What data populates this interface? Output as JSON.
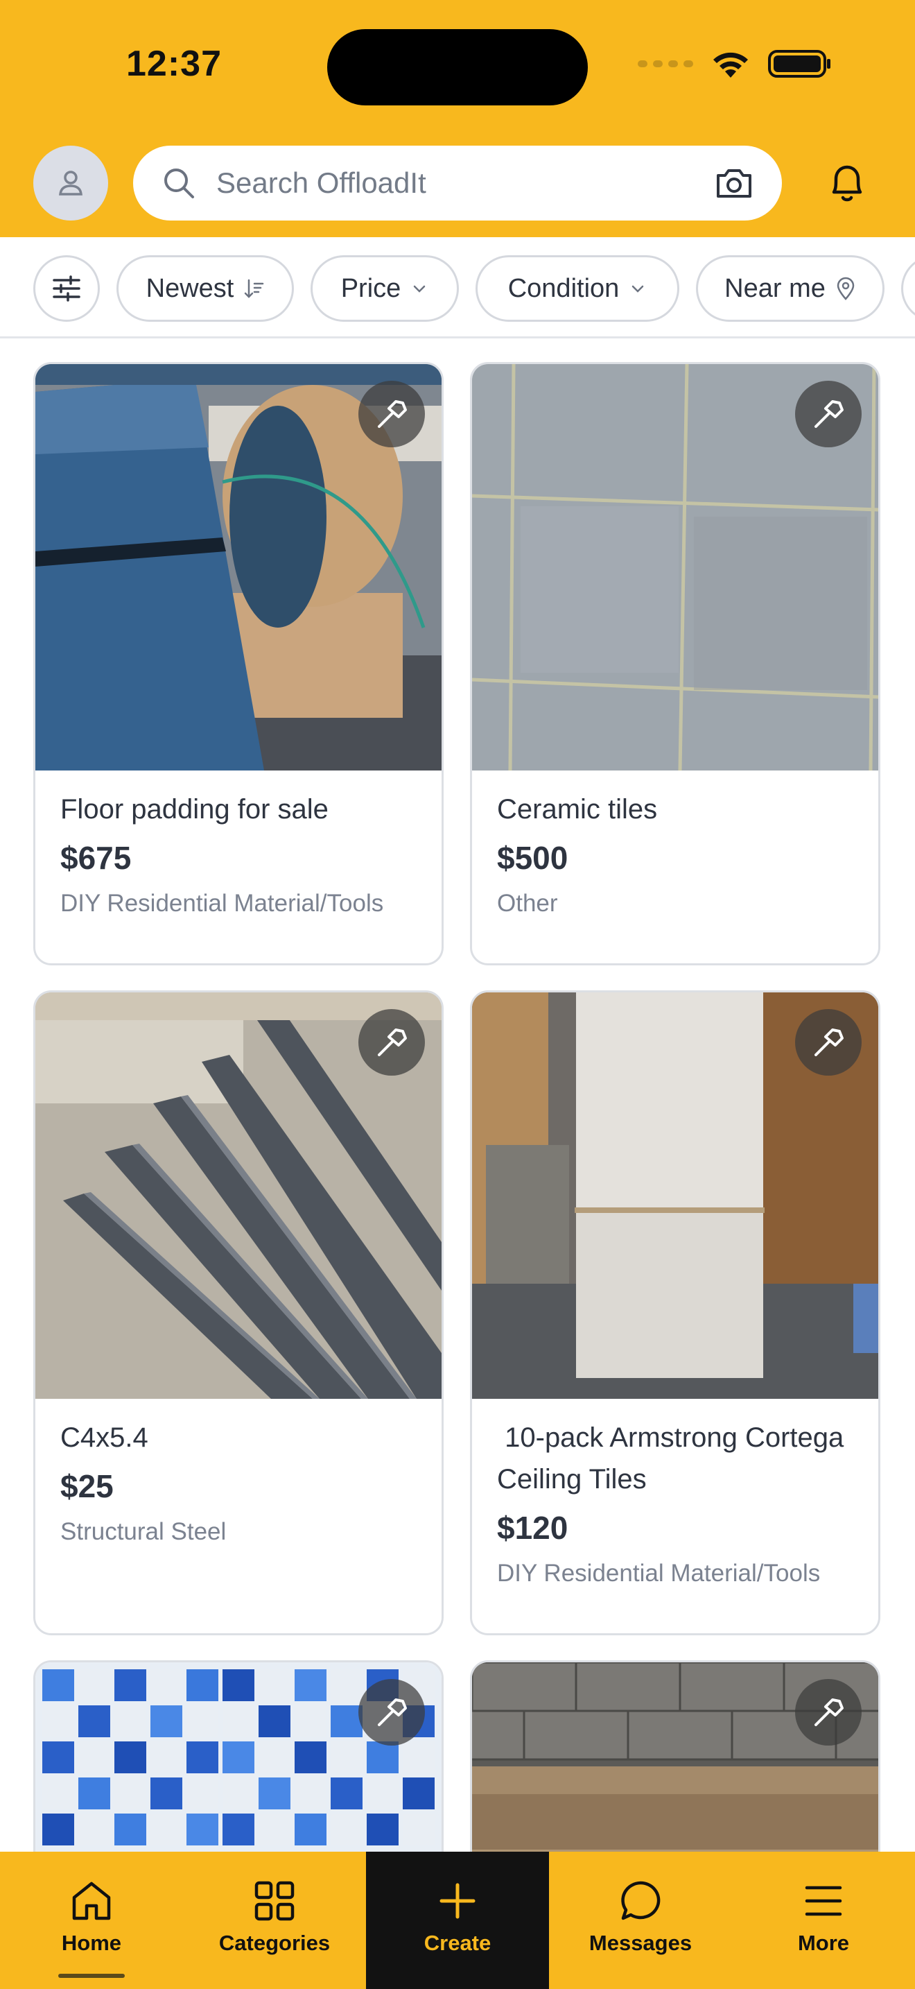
{
  "status_bar": {
    "time": "12:37"
  },
  "header": {
    "search_placeholder": "Search OffloadIt"
  },
  "filters": [
    {
      "label": "Newest"
    },
    {
      "label": "Price"
    },
    {
      "label": "Condition"
    },
    {
      "label": "Near me"
    }
  ],
  "listings": [
    {
      "title": "Floor padding for sale",
      "price": "$675",
      "category": "DIY Residential Material/Tools"
    },
    {
      "title": "Ceramic tiles",
      "price": "$500",
      "category": "Other"
    },
    {
      "title": "C4x5.4",
      "price": "$25",
      "category": "Structural Steel"
    },
    {
      "title": " 10-pack Armstrong Cortega Ceiling Tiles",
      "price": "$120",
      "category": "DIY Residential Material/Tools"
    }
  ],
  "tabbar": {
    "home": "Home",
    "categories": "Categories",
    "create": "Create",
    "messages": "Messages",
    "more": "More"
  },
  "colors": {
    "brand_yellow": "#f8b81e",
    "text_dark": "#2e3440",
    "text_muted": "#7b8290"
  }
}
